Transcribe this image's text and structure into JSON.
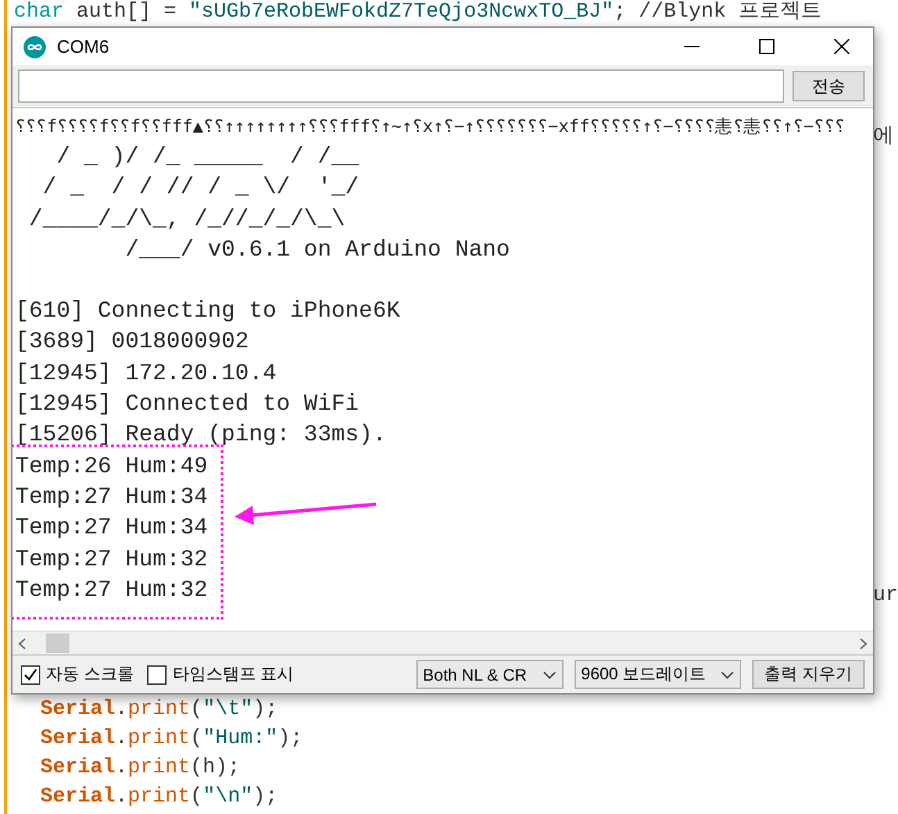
{
  "editor": {
    "top_line": [
      {
        "text": "char",
        "kind": "type"
      },
      {
        "text": " auth[] = ",
        "kind": "plain"
      },
      {
        "text": "\"sUGb7eRobEWFokdZ7TeQjo3NcwxTO_BJ\"",
        "kind": "string"
      },
      {
        "text": "; //Blynk 프로젝트",
        "kind": "comment"
      }
    ],
    "side_fragments": [
      "에",
      "ur"
    ],
    "code_lines": [
      [
        {
          "text": "Serial",
          "kind": "class"
        },
        {
          "text": ".",
          "kind": "plain"
        },
        {
          "text": "print",
          "kind": "method"
        },
        {
          "text": "(",
          "kind": "plain"
        },
        {
          "text": "\"\\t\"",
          "kind": "string"
        },
        {
          "text": ");",
          "kind": "plain"
        }
      ],
      [
        {
          "text": "Serial",
          "kind": "class"
        },
        {
          "text": ".",
          "kind": "plain"
        },
        {
          "text": "print",
          "kind": "method"
        },
        {
          "text": "(",
          "kind": "plain"
        },
        {
          "text": "\"Hum:\"",
          "kind": "string"
        },
        {
          "text": ");",
          "kind": "plain"
        }
      ],
      [
        {
          "text": "Serial",
          "kind": "class"
        },
        {
          "text": ".",
          "kind": "plain"
        },
        {
          "text": "print",
          "kind": "method"
        },
        {
          "text": "(h);",
          "kind": "plain"
        }
      ],
      [
        {
          "text": "Serial",
          "kind": "class"
        },
        {
          "text": ".",
          "kind": "plain"
        },
        {
          "text": "print",
          "kind": "method"
        },
        {
          "text": "(",
          "kind": "plain"
        },
        {
          "text": "\"\\n\"",
          "kind": "string"
        },
        {
          "text": ");",
          "kind": "plain"
        }
      ]
    ]
  },
  "window": {
    "title": "COM6",
    "send_button": "전송",
    "noise_line": "⸮⸮⸮f⸮⸮⸮⸮f⸮⸮f⸮⸮fff▲⸮⸮↑↑↑↑↑↑↑↑⸮⸮⸮fff⸮↑~↑⸮x↑⸮−↑⸮⸮⸮⸮⸮⸮⸮−xff⸮⸮⸮⸮⸮↑⸮−⸮⸮⸮⸮恚⸮恚⸮⸮↑⸮−⸮⸮⸮",
    "banner": [
      "   / _ )/ /_ _____  / /__",
      "  / _  / / // / _ \\/  '_/",
      " /____/_/\\_, /_//_/_/\\_\\",
      "        /___/ v0.6.1 on Arduino Nano"
    ],
    "log": [
      "[610] Connecting to iPhone6K",
      "[3689] 0018000902",
      "[12945] 172.20.10.4",
      "[12945] Connected to WiFi",
      "[15206] Ready (ping: 33ms).",
      "Temp:26 Hum:49",
      "Temp:27 Hum:34",
      "Temp:27 Hum:34",
      "Temp:27 Hum:32",
      "Temp:27 Hum:32"
    ],
    "autoscroll": {
      "label": "자동 스크롤",
      "checked": true
    },
    "timestamp": {
      "label": "타임스탬프 표시",
      "checked": false
    },
    "line_ending": "Both NL & CR",
    "baud_rate": "9600 보드레이트",
    "clear_button": "출력 지우기"
  }
}
